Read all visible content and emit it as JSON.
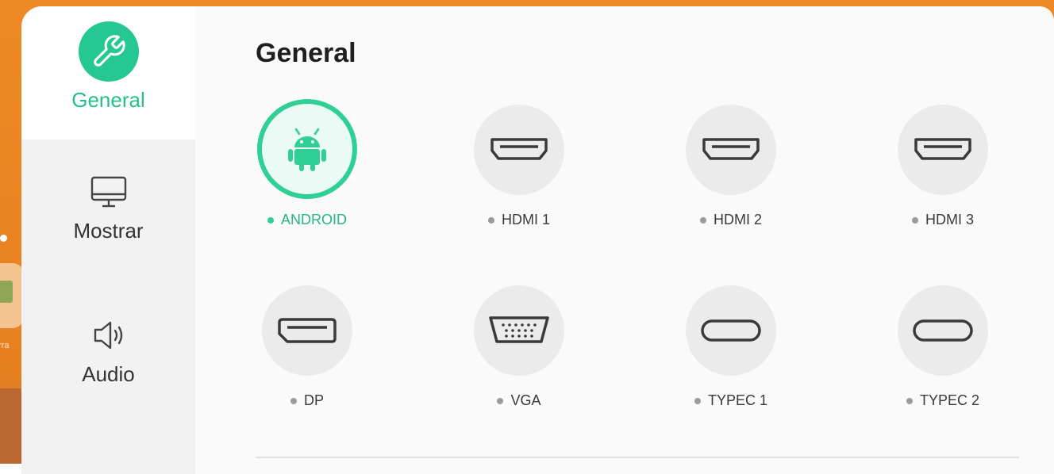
{
  "sidebar": {
    "items": [
      {
        "label": "General",
        "icon": "wrench-icon",
        "active": true
      },
      {
        "label": "Mostrar",
        "icon": "monitor-icon",
        "active": false
      },
      {
        "label": "Audio",
        "icon": "speaker-icon",
        "active": false
      }
    ]
  },
  "background": {
    "app_label": "rra"
  },
  "main": {
    "title": "General",
    "sources": [
      {
        "label": "ANDROID",
        "icon": "android-icon",
        "active": true
      },
      {
        "label": "HDMI 1",
        "icon": "hdmi-icon",
        "active": false
      },
      {
        "label": "HDMI 2",
        "icon": "hdmi-icon",
        "active": false
      },
      {
        "label": "HDMI 3",
        "icon": "hdmi-icon",
        "active": false
      },
      {
        "label": "DP",
        "icon": "displayport-icon",
        "active": false
      },
      {
        "label": "VGA",
        "icon": "vga-icon",
        "active": false
      },
      {
        "label": "TYPEC 1",
        "icon": "usb-c-icon",
        "active": false
      },
      {
        "label": "TYPEC 2",
        "icon": "usb-c-icon",
        "active": false
      }
    ]
  },
  "colors": {
    "accent": "#25c893",
    "background_orange": "#ee8a26",
    "panel": "#fafafa"
  }
}
